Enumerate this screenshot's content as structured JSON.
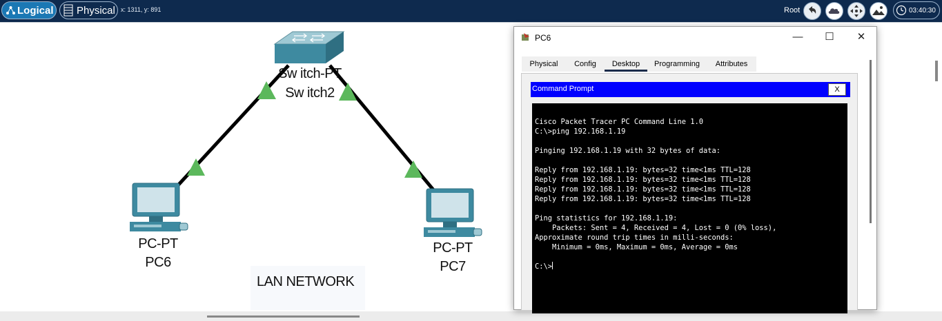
{
  "toolbar": {
    "logical_label": "Logical",
    "physical_label": "Physical",
    "coordinates": "x: 1311, y: 891",
    "root_label": "Root",
    "time": "03:40:30"
  },
  "canvas": {
    "switch": {
      "model": "Sw itch-PT",
      "name": "Sw itch2"
    },
    "pc_left": {
      "model": "PC-PT",
      "name": "PC6"
    },
    "pc_right": {
      "model": "PC-PT",
      "name": "PC7"
    },
    "note": "LAN NETWORK",
    "link_color": "#000000",
    "link_status_color": "#5cb85c"
  },
  "window": {
    "title": "PC6",
    "minimize": "—",
    "maximize": "☐",
    "close": "✕",
    "tabs": [
      {
        "label": "Physical",
        "active": false
      },
      {
        "label": "Config",
        "active": false
      },
      {
        "label": "Desktop",
        "active": true
      },
      {
        "label": "Programming",
        "active": false
      },
      {
        "label": "Attributes",
        "active": false
      }
    ],
    "command_prompt": {
      "title": "Command Prompt",
      "close_label": "X",
      "lines": [
        "Cisco Packet Tracer PC Command Line 1.0",
        "C:\\>ping 192.168.1.19",
        "",
        "Pinging 192.168.1.19 with 32 bytes of data:",
        "",
        "Reply from 192.168.1.19: bytes=32 time<1ms TTL=128",
        "Reply from 192.168.1.19: bytes=32 time<1ms TTL=128",
        "Reply from 192.168.1.19: bytes=32 time<1ms TTL=128",
        "Reply from 192.168.1.19: bytes=32 time<1ms TTL=128",
        "",
        "Ping statistics for 192.168.1.19:",
        "    Packets: Sent = 4, Received = 4, Lost = 0 (0% loss),",
        "Approximate round trip times in milli-seconds:",
        "    Minimum = 0ms, Maximum = 0ms, Average = 0ms",
        ""
      ],
      "prompt": "C:\\>"
    }
  }
}
